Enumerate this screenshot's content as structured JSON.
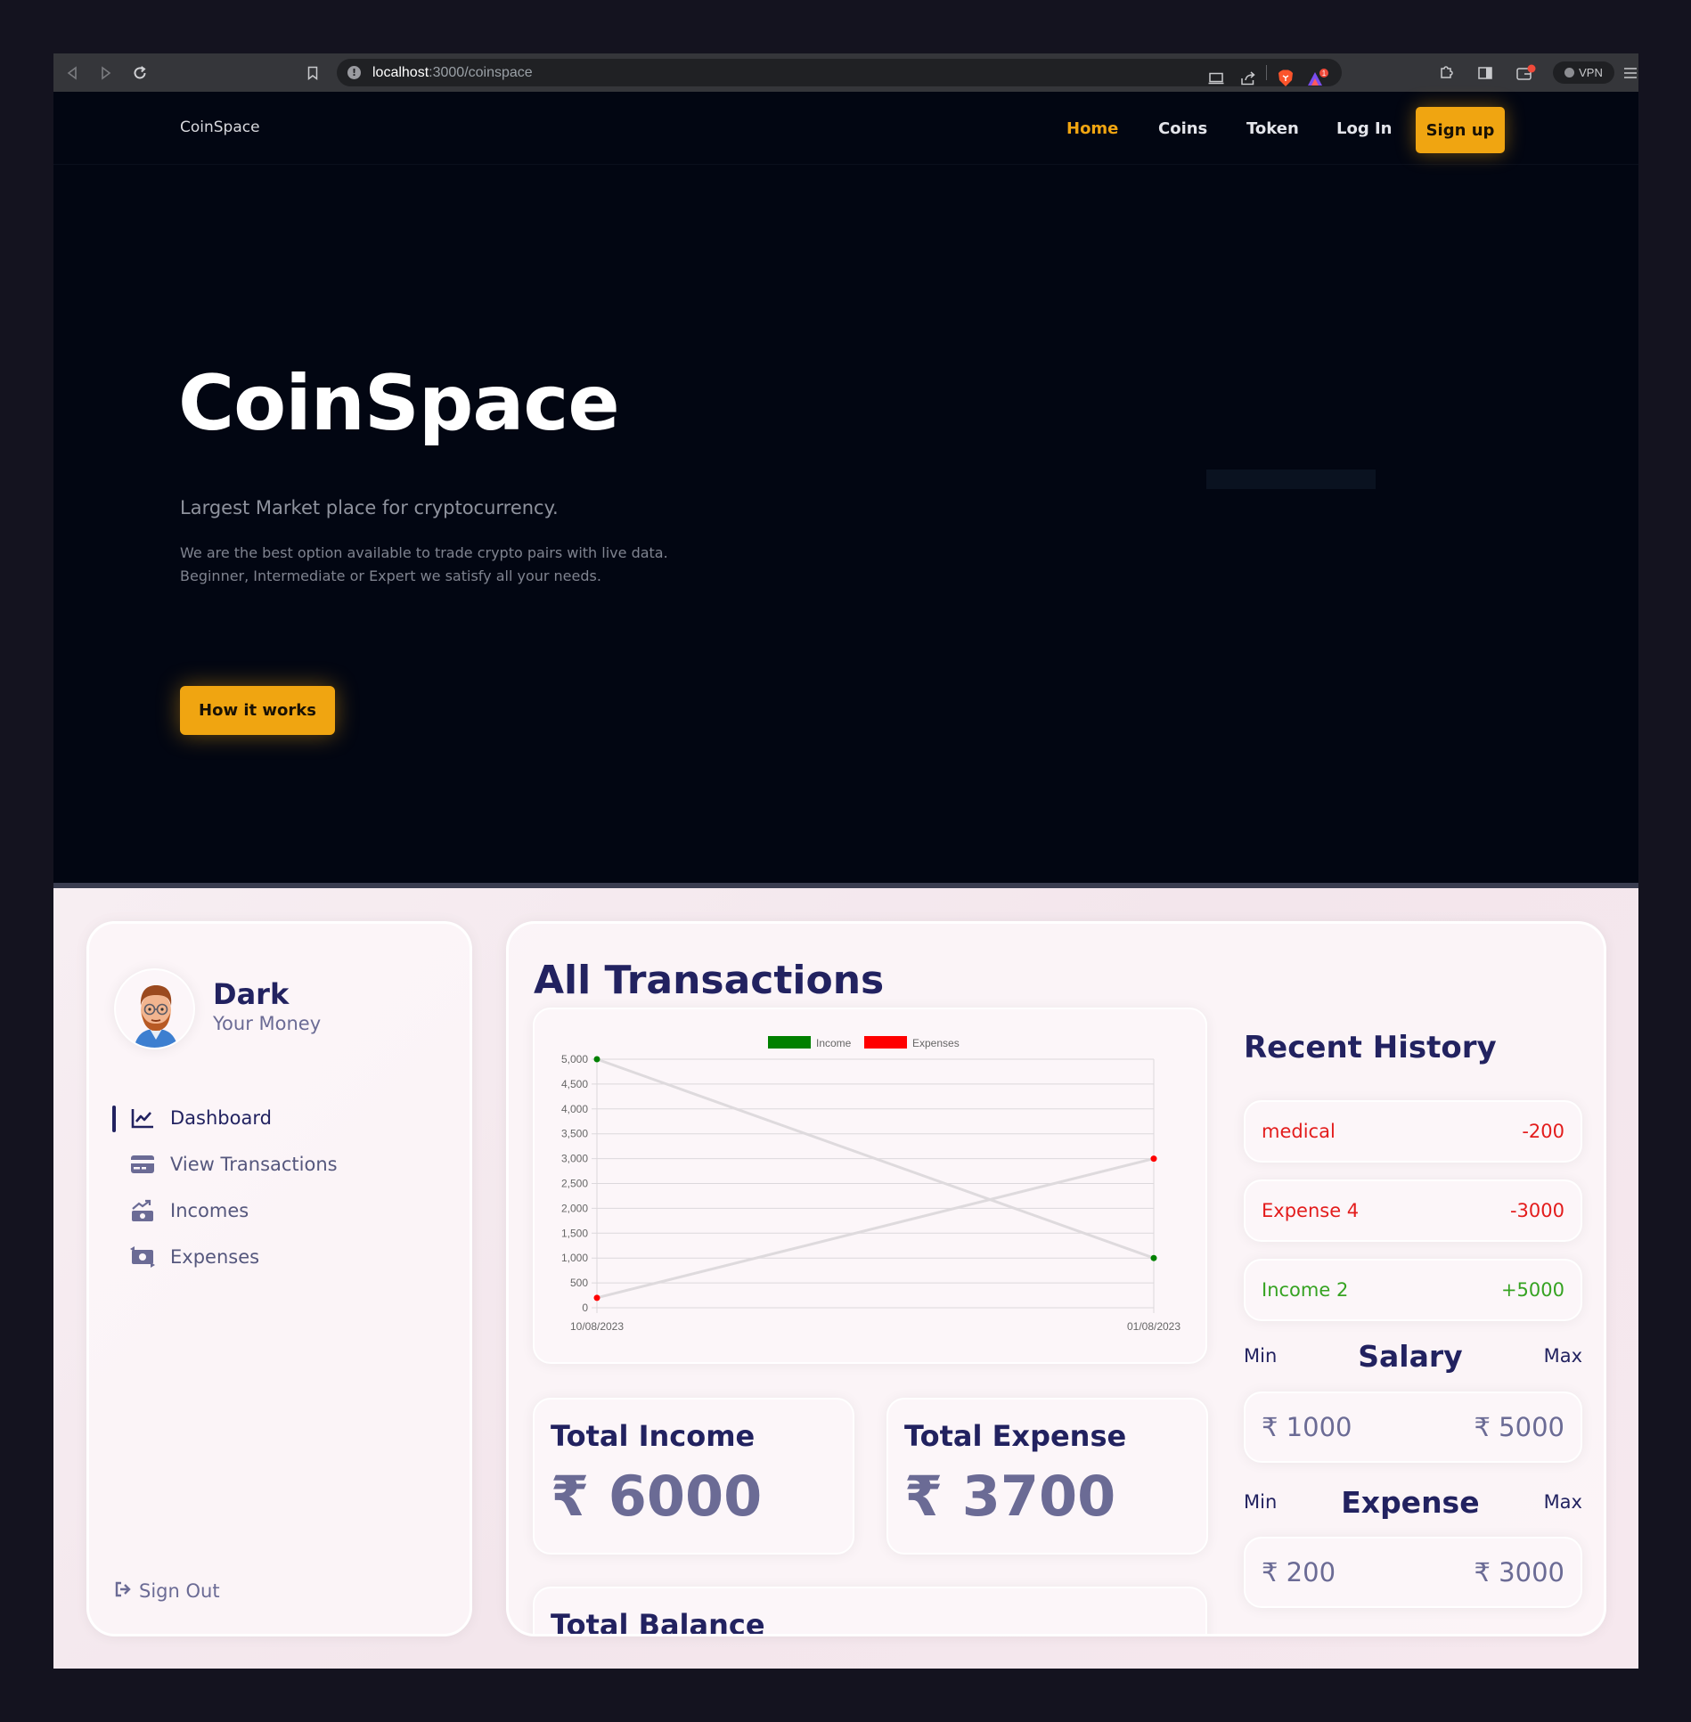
{
  "browser": {
    "url_host": "localhost",
    "url_path": ":3000/coinspace",
    "vpn_label": "VPN",
    "icons": [
      "back-icon",
      "forward-icon",
      "reload-icon",
      "bookmark-icon",
      "cast-icon",
      "share-icon",
      "brave-shield-icon",
      "brave-rewards-icon",
      "extensions-icon",
      "sidebar-icon",
      "wallet-icon",
      "menu-icon"
    ]
  },
  "coinspace": {
    "brand": "CoinSpace",
    "nav": [
      {
        "label": "Home",
        "active": true
      },
      {
        "label": "Coins",
        "active": false
      },
      {
        "label": "Token",
        "active": false
      },
      {
        "label": "Log In",
        "active": false
      }
    ],
    "signup_label": "Sign up",
    "hero_title": "CoinSpace",
    "hero_subtitle": "Largest Market place for cryptocurrency.",
    "hero_desc_line1": "We are the best option available to trade crypto pairs with live data.",
    "hero_desc_line2": "Beginner, Intermediate or Expert we satisfy all your needs.",
    "hero_button": "How it works",
    "accent": "#f0a511",
    "background": "#020612"
  },
  "app": {
    "user": {
      "name": "Dark",
      "subtitle": "Your Money"
    },
    "menu": [
      {
        "label": "Dashboard",
        "icon": "chart-line-icon",
        "active": true
      },
      {
        "label": "View Transactions",
        "icon": "credit-card-icon",
        "active": false
      },
      {
        "label": "Incomes",
        "icon": "money-bill-trend-up-icon",
        "active": false
      },
      {
        "label": "Expenses",
        "icon": "money-bill-transfer-icon",
        "active": false
      }
    ],
    "signout_label": "Sign Out",
    "title": "All Transactions",
    "total_income_label": "Total Income",
    "total_income_value": "₹ 6000",
    "total_expense_label": "Total Expense",
    "total_expense_value": "₹ 3700",
    "total_balance_label": "Total Balance",
    "history_title": "Recent History",
    "history": [
      {
        "title": "medical",
        "amount": "-200",
        "kind": "expense"
      },
      {
        "title": "Expense 4",
        "amount": "-3000",
        "kind": "expense"
      },
      {
        "title": "Income 2",
        "amount": "+5000",
        "kind": "income"
      }
    ],
    "salary": {
      "min_label": "Min",
      "title": "Salary",
      "max_label": "Max",
      "min_value": "₹ 1000",
      "max_value": "₹ 5000"
    },
    "expense": {
      "min_label": "Min",
      "title": "Expense",
      "max_label": "Max",
      "min_value": "₹ 200",
      "max_value": "₹ 3000"
    },
    "colors": {
      "primary": "#222260",
      "muted": "#6b6b95",
      "income": "#36a322",
      "expense": "#e31c1c"
    }
  },
  "chart_data": {
    "type": "line",
    "categories": [
      "10/08/2023",
      "01/08/2023"
    ],
    "series": [
      {
        "name": "Income",
        "values": [
          5000,
          1000
        ],
        "color": "#008000"
      },
      {
        "name": "Expenses",
        "values": [
          200,
          3000
        ],
        "color": "#ff0000"
      }
    ],
    "ylim": [
      0,
      5000
    ],
    "yticks": [
      "5,000",
      "4,500",
      "4,000",
      "3,500",
      "3,000",
      "2,500",
      "2,000",
      "1,500",
      "1,000",
      "500",
      "0"
    ],
    "ytick_values": [
      5000,
      4500,
      4000,
      3500,
      3000,
      2500,
      2000,
      1500,
      1000,
      500,
      0
    ],
    "grid": true,
    "legend": "top"
  }
}
